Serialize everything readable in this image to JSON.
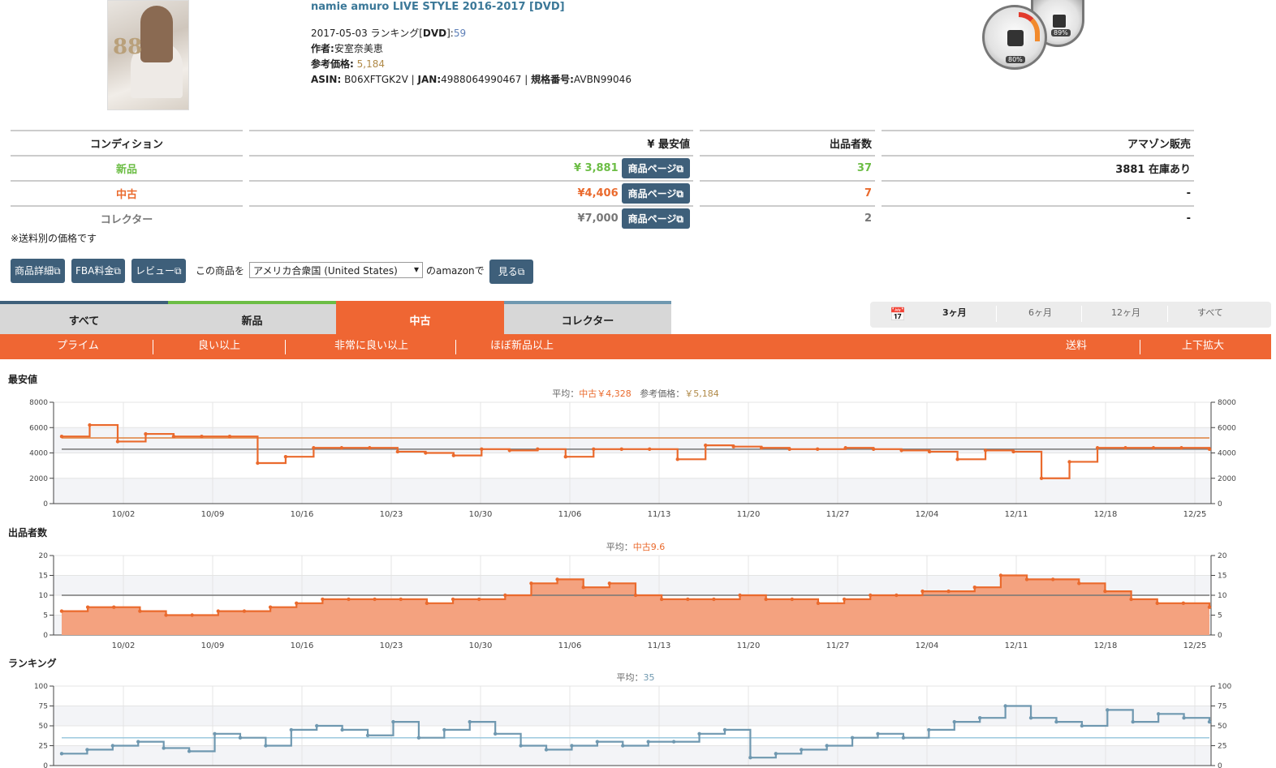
{
  "product": {
    "title": "namie amuro LIVE STYLE 2016-2017 [DVD]",
    "date_rank_prefix": "2017-05-03 ランキング[",
    "rank_cat": "DVD",
    "rank_close": "]:",
    "rank_value": "59",
    "author_label": "作者:",
    "author": "安室奈美恵",
    "ref_price_label": "参考価格:",
    "ref_price": "5,184",
    "asin_label": "ASIN:",
    "asin": "B06XFTGK2V",
    "jan_label": "JAN:",
    "jan": "4988064990467",
    "model_label": "規格番号:",
    "model": "AVBN99046",
    "sep": "|",
    "thumb_text": "88",
    "gauge_big": "80%",
    "gauge_small": "89%"
  },
  "table": {
    "headers": [
      "コンディション",
      "¥ 最安値",
      "出品者数",
      "アマゾン販売"
    ],
    "rows": [
      {
        "cond": "新品",
        "price": "¥ 3,881",
        "btn": "商品ページ",
        "count": "37",
        "amazon": "3881 在庫あり"
      },
      {
        "cond": "中古",
        "price": "¥4,406",
        "btn": "商品ページ",
        "count": "7",
        "amazon": "-"
      },
      {
        "cond": "コレクター",
        "price": "¥7,000",
        "btn": "商品ページ",
        "count": "2",
        "amazon": "-"
      }
    ],
    "note": "※送料別の価格です"
  },
  "actions": {
    "detail": "商品詳細",
    "fba": "FBA料金",
    "review": "レビュー",
    "prefix": "この商品を",
    "country": "アメリカ合衆国 (United States)",
    "suffix": "のamazonで",
    "view": "見る"
  },
  "tabs": [
    "すべて",
    "新品",
    "中古",
    "コレクター"
  ],
  "subfilters": [
    "プライム",
    "良い以上",
    "非常に良い以上",
    "ほぼ新品以上"
  ],
  "subright": [
    "送料",
    "上下拡大"
  ],
  "ranges": [
    "3ヶ月",
    "6ヶ月",
    "12ヶ月",
    "すべて"
  ],
  "colors": {
    "accent": "#ef6633",
    "green": "#6cbd45",
    "blue": "#6f98b0",
    "gold": "#b08a48",
    "button": "#3e5f7a"
  },
  "chart_data": [
    {
      "type": "line",
      "section": "最安値",
      "avg_label": "平均：",
      "avg_value": "中古￥4,328",
      "ref_label": "参考価格：",
      "ref_value": "￥5,184",
      "ylim": [
        0,
        8000
      ],
      "yticks": [
        "8000",
        "6000",
        "4000",
        "2000",
        "0"
      ],
      "x": [
        "10/02",
        "10/09",
        "10/16",
        "10/23",
        "10/30",
        "11/06",
        "11/13",
        "11/20",
        "11/27",
        "12/04",
        "12/11",
        "12/18",
        "12/25"
      ],
      "ref_line": 5184,
      "new_line": 4300,
      "series": [
        {
          "values": [
            5300,
            6200,
            4900,
            5500,
            5300,
            5300,
            5300,
            3200,
            3700,
            4400,
            4400,
            4400,
            4100,
            4000,
            3800,
            4300,
            4200,
            4300,
            3700,
            4300,
            4300,
            4300,
            3500,
            4600,
            4500,
            4400,
            4300,
            4300,
            4400,
            4300,
            4200,
            4100,
            3500,
            4200,
            4100,
            2000,
            3300,
            4400,
            4400,
            4400,
            4400,
            4300
          ]
        }
      ]
    },
    {
      "type": "area",
      "section": "出品者数",
      "avg_label": "平均：",
      "avg_value": "中古9.6",
      "ylim": [
        0,
        20
      ],
      "yticks": [
        "20",
        "15",
        "10",
        "5",
        "0"
      ],
      "x": [
        "10/02",
        "10/09",
        "10/16",
        "10/23",
        "10/30",
        "11/06",
        "11/13",
        "11/20",
        "11/27",
        "12/04",
        "12/11",
        "12/18",
        "12/25"
      ],
      "ref_line": 10,
      "series": [
        {
          "values": [
            6,
            7,
            7,
            6,
            5,
            5,
            6,
            6,
            7,
            8,
            9,
            9,
            9,
            9,
            8,
            9,
            9,
            10,
            13,
            14,
            12,
            13,
            10,
            9,
            9,
            9,
            10,
            9,
            9,
            8,
            9,
            10,
            10,
            11,
            11,
            12,
            15,
            14,
            14,
            13,
            11,
            9,
            8,
            8,
            7
          ]
        }
      ]
    },
    {
      "type": "line",
      "section": "ランキング",
      "avg_label": "平均：",
      "avg_value": "35",
      "ylim": [
        0,
        100
      ],
      "yticks": [
        "100",
        "75",
        "50",
        "25",
        "0"
      ],
      "x": [
        "10/02",
        "10/09",
        "10/16",
        "10/23",
        "10/30",
        "11/06",
        "11/13",
        "11/20",
        "11/27",
        "12/04",
        "12/11",
        "12/18",
        "12/25"
      ],
      "ref_line": 35,
      "series": [
        {
          "values": [
            15,
            20,
            25,
            30,
            22,
            18,
            40,
            35,
            25,
            45,
            50,
            45,
            38,
            55,
            35,
            45,
            55,
            40,
            25,
            20,
            25,
            30,
            25,
            30,
            30,
            40,
            45,
            10,
            15,
            20,
            25,
            35,
            40,
            35,
            45,
            55,
            60,
            75,
            60,
            55,
            50,
            70,
            55,
            65,
            60,
            55
          ]
        }
      ]
    }
  ]
}
